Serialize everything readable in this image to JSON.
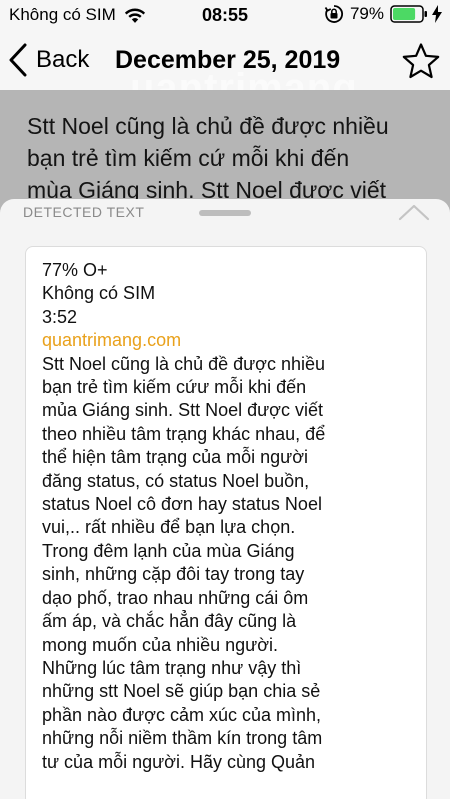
{
  "status_bar": {
    "carrier": "Không có SIM",
    "time": "08:55",
    "battery": "79%",
    "battery_level": 0.79
  },
  "nav": {
    "back_label": "Back",
    "title": "December 25, 2019",
    "watermark": "uantrimang"
  },
  "article_lines": [
    "Stt Noel cũng là chủ đề được nhiều",
    "bạn trẻ tìm kiếm cứ mỗi khi đến",
    "mùa Giáng sinh. Stt Noel được viết"
  ],
  "sheet": {
    "title": "DETECTED TEXT",
    "lines": [
      "77% O+",
      "Không có SIM",
      "3:52",
      "quantrimang.com",
      "Stt Noel cũng là chủ đề được nhiều",
      "bạn trẻ tìm kiếm cứư mỗi khi đến",
      "mủa Giáng sinh. Stt Noel được viết",
      "theo nhiều tâm trạng khác nhau, để",
      "thể hiện tâm trạng của mỗi người",
      "đăng status, có status Noel buồn,",
      "status Noel cô đơn hay status Noel",
      "vui,.. rất nhiều để bạn lựa chọn.",
      "Trong đêm lạnh của mùa Giáng",
      "sinh, những cặp đôi tay trong tay",
      "dạo phố, trao nhau những cái ôm",
      "ấm áp, và chắc hẳn đây cũng là",
      "mong muốn của nhiều người.",
      "Những lúc tâm trạng như vậy thì",
      "những stt Noel sẽ giúp bạn chia sẻ",
      "phần nào được cảm xúc của mình,",
      "những nỗi niềm thầm kín trong tâm",
      "tư của mỗi người. Hãy cùng Quản"
    ],
    "link_color": "#e9a11b"
  }
}
